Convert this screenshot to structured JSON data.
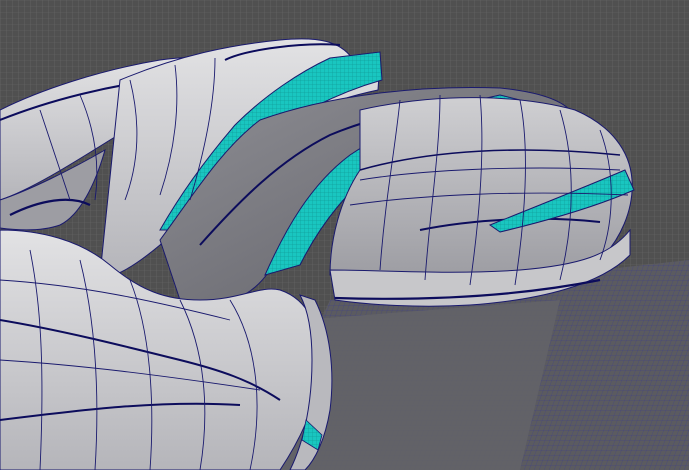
{
  "viewport": {
    "type": "3d-modeling-viewport",
    "shading": "wireframe-on-shaded",
    "colors": {
      "background": "#4a4a4a",
      "floor_grid_line": "#6a6a6a",
      "floor_plate": "#5e5e5e",
      "floor_plate_grid": "#3c3c8c",
      "surface_light": "#d6d6d8",
      "surface_mid": "#a9a9ae",
      "surface_dark": "#6e6e74",
      "wire": "#1a1a6e",
      "wire_heavy": "#0c0c5c",
      "selection_face": "#19c6c0",
      "selection_face_dark": "#0e9c98"
    }
  }
}
